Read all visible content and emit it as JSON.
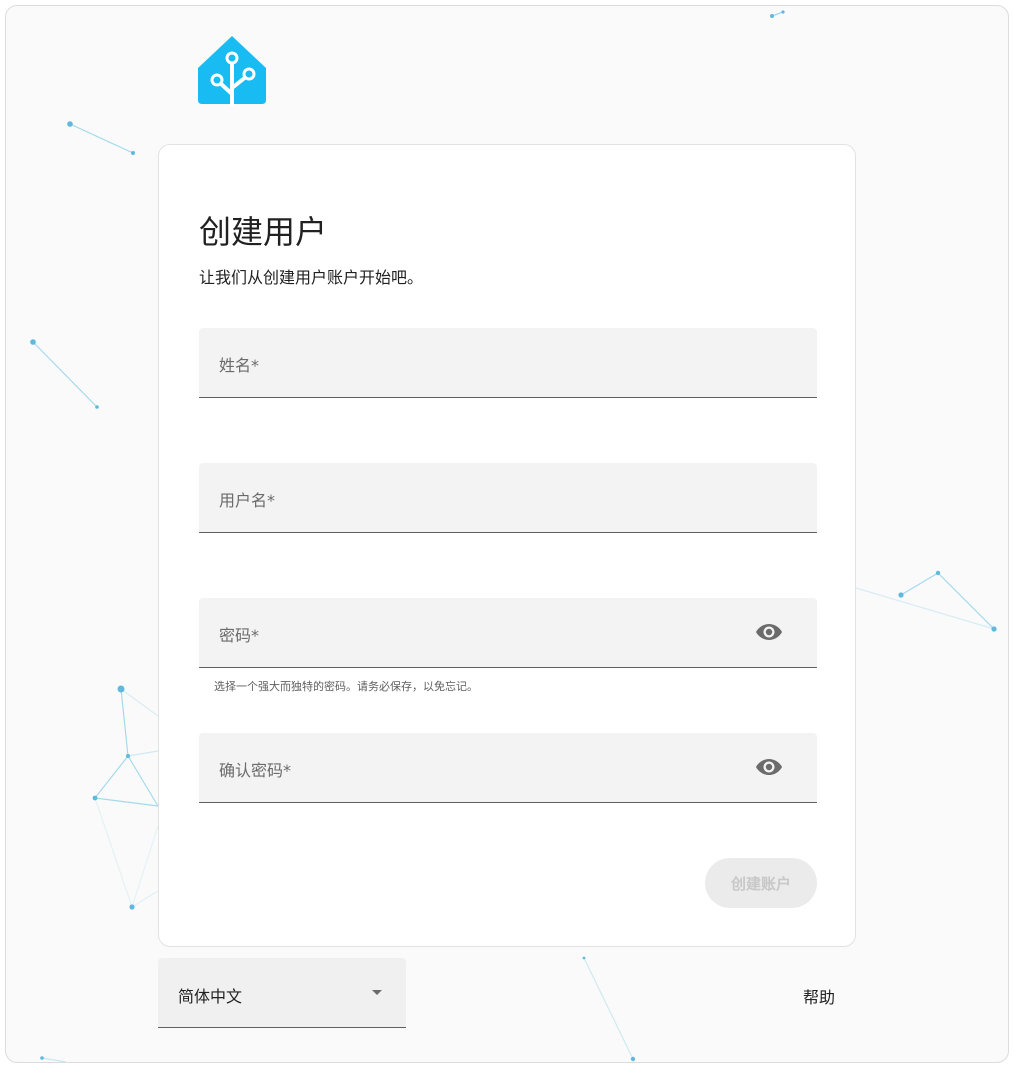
{
  "brand": {
    "logo_icon": "home-assistant-logo-icon",
    "accent": "#18bcf2"
  },
  "card": {
    "title": "创建用户",
    "subtitle": "让我们从创建用户账户开始吧。"
  },
  "fields": {
    "name_label": "姓名*",
    "username_label": "用户名*",
    "password_label": "密码*",
    "password_helper": "选择一个强大而独特的密码。请务必保存，以免忘记。",
    "confirm_label": "确认密码*",
    "eye_icon": "eye-icon"
  },
  "submit": {
    "label": "创建账户",
    "disabled": true
  },
  "footer": {
    "language_value": "简体中文",
    "help_label": "帮助"
  }
}
